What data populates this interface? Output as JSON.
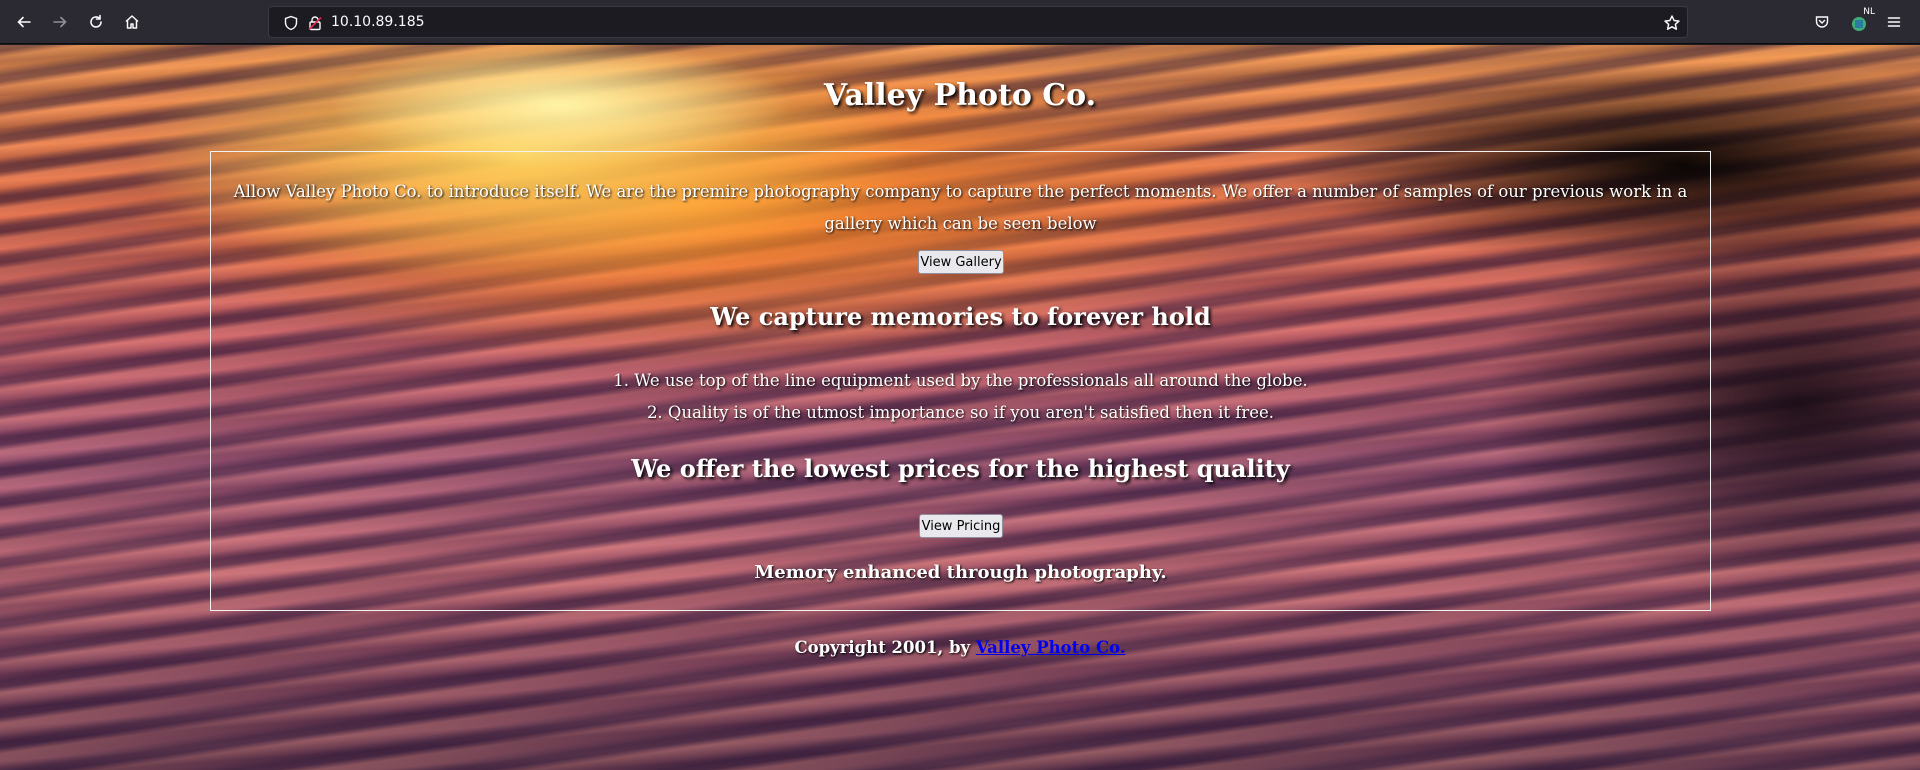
{
  "browser": {
    "url": "10.10.89.185",
    "extension_badge": "NL",
    "icons": {
      "back": "back-arrow-icon",
      "forward": "forward-arrow-icon",
      "reload": "reload-icon",
      "home": "home-icon",
      "shield": "shield-icon",
      "lock": "insecure-lock-icon",
      "bookmark": "star-icon",
      "pocket": "pocket-icon",
      "menu": "hamburger-menu-icon"
    }
  },
  "page": {
    "title": "Valley Photo Co.",
    "intro": "Allow Valley Photo Co. to introduce itself. We are the premire photography company to capture the perfect moments. We offer a number of samples of our previous work in a gallery which can be seen below",
    "gallery_button": "View Gallery",
    "heading_capture": "We capture memories to forever hold",
    "list": [
      "1. We use top of the line equipment used by the professionals all around the globe.",
      "2. Quality is of the utmost importance so if you aren't satisfied then it free."
    ],
    "heading_prices": "We offer the lowest prices for the highest quality",
    "pricing_button": "View Pricing",
    "tagline": "Memory enhanced through photography.",
    "footer_prefix": "Copyright 2001, by ",
    "footer_link": "Valley Photo Co."
  },
  "colors": {
    "chrome_bg": "#2b2a33",
    "url_bg": "#1c1b22",
    "link": "#0000ee",
    "text": "#ffffff"
  }
}
